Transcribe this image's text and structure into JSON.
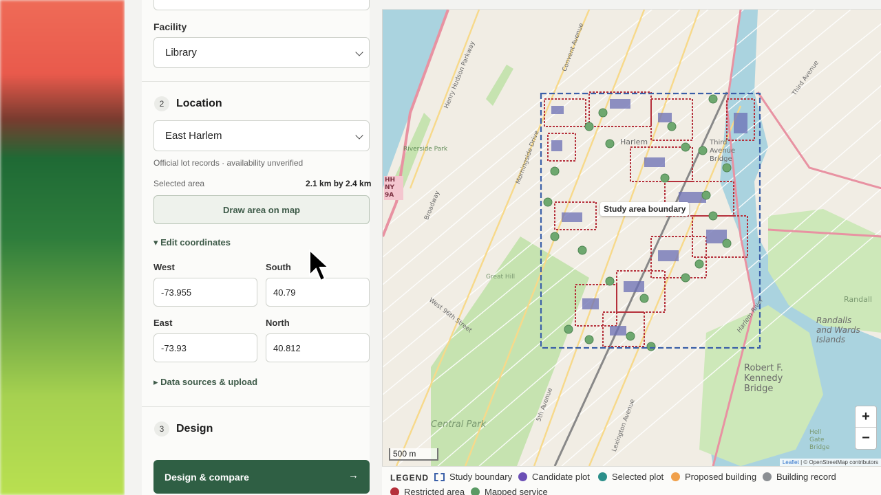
{
  "facility": {
    "label": "Facility",
    "value": "Library"
  },
  "location": {
    "step": "2",
    "title": "Location",
    "value": "East Harlem",
    "note": "Official lot records · availability unverified",
    "selected_label": "Selected area",
    "selected_value": "2.1 km by 2.4 km",
    "draw_button": "Draw area on map",
    "edit_coords": "▾ Edit coordinates",
    "west_label": "West",
    "west_value": "-73.955",
    "south_label": "South",
    "south_value": "40.79",
    "east_label": "East",
    "east_value": "-73.93",
    "north_label": "North",
    "north_value": "40.812",
    "data_sources": "▸ Data sources & upload"
  },
  "design": {
    "step": "3",
    "title": "Design",
    "cta": "Design & compare",
    "cta_arrow": "→"
  },
  "map": {
    "boundary_label": "Study area boundary",
    "scale": "500 m",
    "zoom_in": "+",
    "zoom_out": "−",
    "attribution_leaflet": "Leaflet",
    "attribution_rest": " | © OpenStreetMap contributors",
    "labels": {
      "harlem": "Harlem",
      "third_ave_bridge": "Third Avenue Bridge",
      "randalls": "Randalls and Wards Islands",
      "rfk": "Robert F. Kennedy Bridge",
      "central_park": "Central Park",
      "riverside": "Riverside Park",
      "morningside": "Morningside Drive",
      "broadway": "Broadway",
      "w96": "West 96th Street",
      "lexington": "Lexington Avenue",
      "fifth": "5th Avenue",
      "hh": "HH NY 9A",
      "harlem_river": "Harlem River",
      "hudson_pkwy": "Henry Hudson Parkway",
      "great_hill": "Great Hill",
      "third_ave": "Third Avenue",
      "convent": "Convent Avenue",
      "randall": "Randall",
      "hell_gate": "Hell Gate Bridge"
    }
  },
  "legend": {
    "title": "LEGEND",
    "items": [
      {
        "label": "Study boundary",
        "color": "#3a5fa8"
      },
      {
        "label": "Candidate plot",
        "color": "#6b4fb5"
      },
      {
        "label": "Selected plot",
        "color": "#2b8f8a"
      },
      {
        "label": "Proposed building",
        "color": "#f0a04b"
      },
      {
        "label": "Building record",
        "color": "#8b8f93"
      },
      {
        "label": "Restricted area",
        "color": "#b5303b"
      },
      {
        "label": "Mapped service",
        "color": "#5a9a64"
      }
    ]
  }
}
